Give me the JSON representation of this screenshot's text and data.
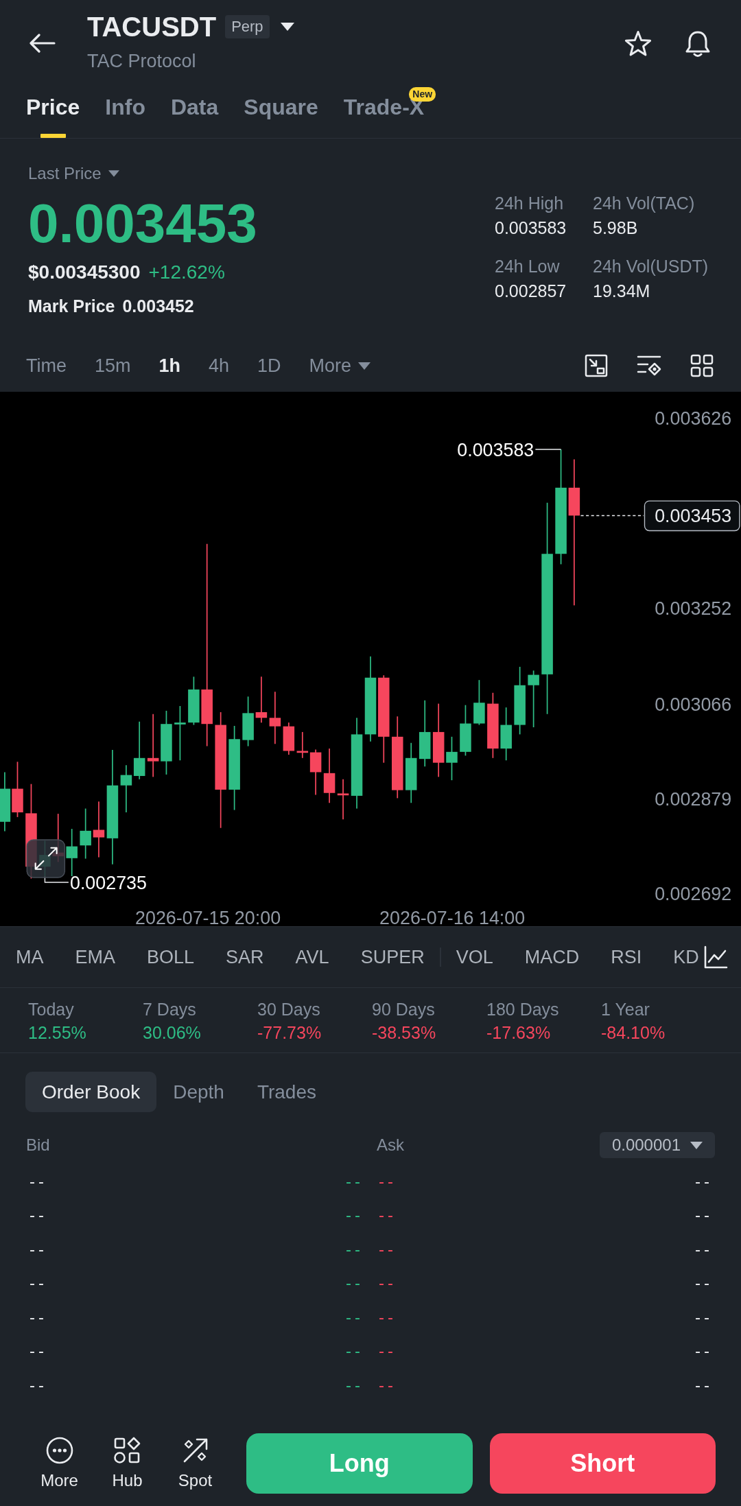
{
  "header": {
    "title": "TACUSDT",
    "badge": "Perp",
    "subtitle": "TAC Protocol"
  },
  "tabs": [
    {
      "label": "Price",
      "selected": true
    },
    {
      "label": "Info",
      "selected": false
    },
    {
      "label": "Data",
      "selected": false
    },
    {
      "label": "Square",
      "selected": false
    },
    {
      "label": "Trade-X",
      "selected": false,
      "badge": "New"
    }
  ],
  "price": {
    "label": "Last Price",
    "last": "0.003453",
    "rising": true,
    "usd": "$0.00345300",
    "change": "+12.62%",
    "mark_label": "Mark Price",
    "mark": "0.003452",
    "stats": [
      {
        "label": "24h High",
        "value": "0.003583"
      },
      {
        "label": "24h Vol(TAC)",
        "value": "5.98B"
      },
      {
        "label": "24h Low",
        "value": "0.002857"
      },
      {
        "label": "24h Vol(USDT)",
        "value": "19.34M"
      }
    ]
  },
  "intervals": [
    {
      "label": "Time",
      "kind": "option",
      "selected": false
    },
    {
      "label": "15m",
      "kind": "option",
      "selected": false
    },
    {
      "label": "1h",
      "kind": "option",
      "selected": true
    },
    {
      "label": "4h",
      "kind": "option",
      "selected": false
    },
    {
      "label": "1D",
      "kind": "option",
      "selected": false
    },
    {
      "label": "More",
      "kind": "menu",
      "selected": false
    }
  ],
  "chart": {
    "price_labels": [
      "0.003626",
      "0.003252",
      "0.003066",
      "0.002879",
      "0.002692"
    ],
    "time_labels": [
      "2026-07-15 20:00",
      "2026-07-16 14:00"
    ],
    "high_label": "0.003583",
    "low_label": "0.002735",
    "last_price_label": "0.003453"
  },
  "indicators": {
    "main": [
      "MA",
      "EMA",
      "BOLL",
      "SAR",
      "AVL",
      "SUPER"
    ],
    "sub": [
      "VOL",
      "MACD",
      "RSI",
      "KD"
    ]
  },
  "performance": [
    {
      "label": "Today",
      "value": "12.55%",
      "color": "#2ebd85"
    },
    {
      "label": "7 Days",
      "value": "30.06%",
      "color": "#2ebd85"
    },
    {
      "label": "30 Days",
      "value": "-77.73%",
      "color": "#f6465d"
    },
    {
      "label": "90 Days",
      "value": "-38.53%",
      "color": "#f6465d"
    },
    {
      "label": "180 Days",
      "value": "-17.63%",
      "color": "#f6465d"
    },
    {
      "label": "1 Year",
      "value": "-84.10%",
      "color": "#f6465d"
    }
  ],
  "order_book": {
    "tabs": [
      {
        "label": "Order Book",
        "selected": true
      },
      {
        "label": "Depth",
        "selected": false
      },
      {
        "label": "Trades",
        "selected": false
      }
    ],
    "bid_header": "Bid",
    "ask_header": "Ask",
    "precision": "0.000001",
    "rows": [
      {
        "bid_amount": "--",
        "bid_price": "--",
        "ask_price": "--",
        "ask_amount": "--"
      },
      {
        "bid_amount": "--",
        "bid_price": "--",
        "ask_price": "--",
        "ask_amount": "--"
      },
      {
        "bid_amount": "--",
        "bid_price": "--",
        "ask_price": "--",
        "ask_amount": "--"
      },
      {
        "bid_amount": "--",
        "bid_price": "--",
        "ask_price": "--",
        "ask_amount": "--"
      },
      {
        "bid_amount": "--",
        "bid_price": "--",
        "ask_price": "--",
        "ask_amount": "--"
      },
      {
        "bid_amount": "--",
        "bid_price": "--",
        "ask_price": "--",
        "ask_amount": "--"
      },
      {
        "bid_amount": "--",
        "bid_price": "--",
        "ask_price": "--",
        "ask_amount": "--"
      }
    ]
  },
  "bottom_bar": {
    "shortcuts": [
      {
        "label": "More"
      },
      {
        "label": "Hub"
      },
      {
        "label": "Spot"
      }
    ],
    "long": "Long",
    "short": "Short"
  }
}
